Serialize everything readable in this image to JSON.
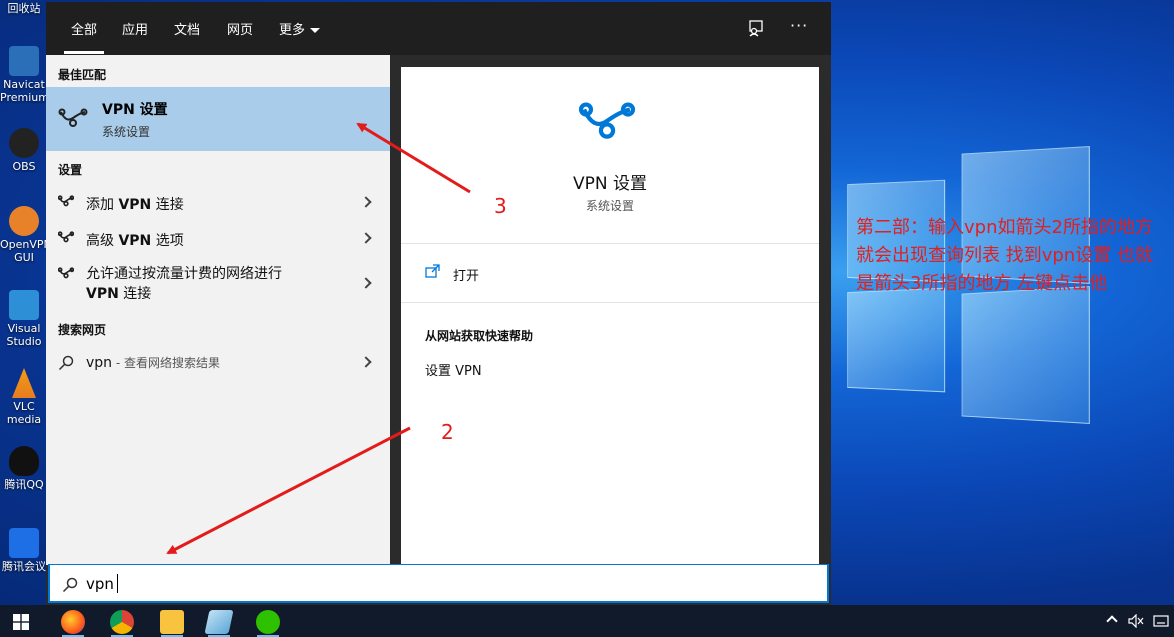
{
  "desktop": {
    "icons": [
      {
        "label": "回收站",
        "icon": "recycle-bin-icon"
      },
      {
        "label": "Navicat Premium",
        "icon": "navicat-icon"
      },
      {
        "label": "OBS Studio",
        "icon": "obs-icon"
      },
      {
        "label": "OpenVPN GUI",
        "icon": "openvpn-icon"
      },
      {
        "label": "Visual Studio Code",
        "icon": "vscode-icon"
      },
      {
        "label": "VLC media player",
        "icon": "vlc-icon"
      },
      {
        "label": "腾讯QQ",
        "icon": "qq-icon"
      },
      {
        "label": "腾讯会议",
        "icon": "tencent-meeting-icon"
      }
    ]
  },
  "search_panel": {
    "tabs": [
      {
        "label": "全部",
        "active": true
      },
      {
        "label": "应用"
      },
      {
        "label": "文档"
      },
      {
        "label": "网页"
      },
      {
        "label": "更多"
      }
    ],
    "best_match_heading": "最佳匹配",
    "best_match": {
      "title": "VPN 设置",
      "subtitle": "系统设置",
      "icon": "vpn-icon"
    },
    "settings_heading": "设置",
    "settings_items": [
      {
        "prefix": "添加 ",
        "bold": "VPN",
        "suffix": " 连接"
      },
      {
        "prefix": "高级 ",
        "bold": "VPN",
        "suffix": " 选项"
      },
      {
        "line1": "允许通过按流量计费的网络进行",
        "bold": "VPN",
        "suffix": " 连接"
      }
    ],
    "web_heading": "搜索网页",
    "web_item": {
      "query": "vpn",
      "hint": " - 查看网络搜索结果"
    },
    "detail": {
      "title": "VPN 设置",
      "subtitle": "系统设置",
      "open_label": "打开",
      "help_heading": "从网站获取快速帮助",
      "help_link": "设置 VPN"
    },
    "search_value": "vpn"
  },
  "annotations": {
    "arrow2_label": "2",
    "arrow3_label": "3",
    "instruction": "第二部：输入vpn如箭头2所指的地方   就会出现查询列表  找到vpn设置  也就是箭头3所指的地方  左键点击他"
  },
  "colors": {
    "accent": "#0078d7",
    "selection": "#a8cce9",
    "annotation": "#e02020"
  }
}
